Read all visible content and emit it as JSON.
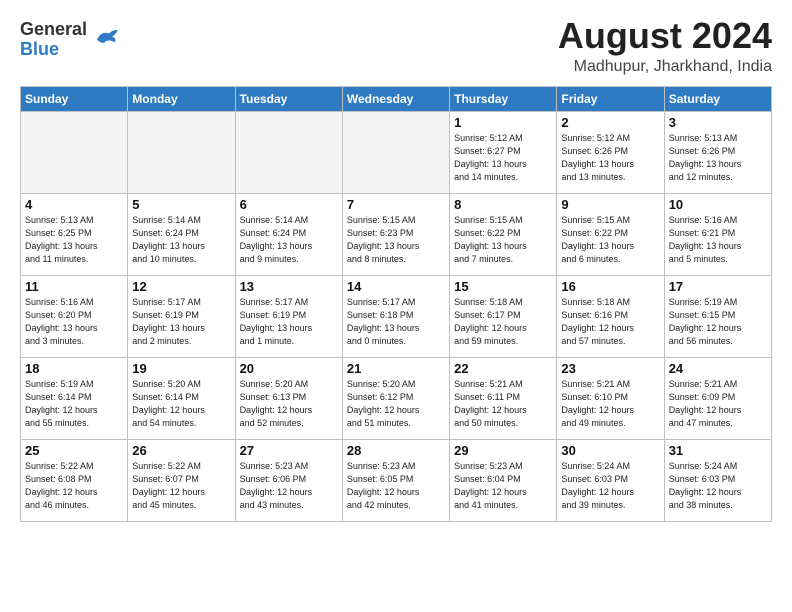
{
  "header": {
    "logo": {
      "line1": "General",
      "line2": "Blue"
    },
    "title": "August 2024",
    "subtitle": "Madhupur, Jharkhand, India"
  },
  "weekdays": [
    "Sunday",
    "Monday",
    "Tuesday",
    "Wednesday",
    "Thursday",
    "Friday",
    "Saturday"
  ],
  "weeks": [
    [
      {
        "day": "",
        "info": ""
      },
      {
        "day": "",
        "info": ""
      },
      {
        "day": "",
        "info": ""
      },
      {
        "day": "",
        "info": ""
      },
      {
        "day": "1",
        "info": "Sunrise: 5:12 AM\nSunset: 6:27 PM\nDaylight: 13 hours\nand 14 minutes."
      },
      {
        "day": "2",
        "info": "Sunrise: 5:12 AM\nSunset: 6:26 PM\nDaylight: 13 hours\nand 13 minutes."
      },
      {
        "day": "3",
        "info": "Sunrise: 5:13 AM\nSunset: 6:26 PM\nDaylight: 13 hours\nand 12 minutes."
      }
    ],
    [
      {
        "day": "4",
        "info": "Sunrise: 5:13 AM\nSunset: 6:25 PM\nDaylight: 13 hours\nand 11 minutes."
      },
      {
        "day": "5",
        "info": "Sunrise: 5:14 AM\nSunset: 6:24 PM\nDaylight: 13 hours\nand 10 minutes."
      },
      {
        "day": "6",
        "info": "Sunrise: 5:14 AM\nSunset: 6:24 PM\nDaylight: 13 hours\nand 9 minutes."
      },
      {
        "day": "7",
        "info": "Sunrise: 5:15 AM\nSunset: 6:23 PM\nDaylight: 13 hours\nand 8 minutes."
      },
      {
        "day": "8",
        "info": "Sunrise: 5:15 AM\nSunset: 6:22 PM\nDaylight: 13 hours\nand 7 minutes."
      },
      {
        "day": "9",
        "info": "Sunrise: 5:15 AM\nSunset: 6:22 PM\nDaylight: 13 hours\nand 6 minutes."
      },
      {
        "day": "10",
        "info": "Sunrise: 5:16 AM\nSunset: 6:21 PM\nDaylight: 13 hours\nand 5 minutes."
      }
    ],
    [
      {
        "day": "11",
        "info": "Sunrise: 5:16 AM\nSunset: 6:20 PM\nDaylight: 13 hours\nand 3 minutes."
      },
      {
        "day": "12",
        "info": "Sunrise: 5:17 AM\nSunset: 6:19 PM\nDaylight: 13 hours\nand 2 minutes."
      },
      {
        "day": "13",
        "info": "Sunrise: 5:17 AM\nSunset: 6:19 PM\nDaylight: 13 hours\nand 1 minute."
      },
      {
        "day": "14",
        "info": "Sunrise: 5:17 AM\nSunset: 6:18 PM\nDaylight: 13 hours\nand 0 minutes."
      },
      {
        "day": "15",
        "info": "Sunrise: 5:18 AM\nSunset: 6:17 PM\nDaylight: 12 hours\nand 59 minutes."
      },
      {
        "day": "16",
        "info": "Sunrise: 5:18 AM\nSunset: 6:16 PM\nDaylight: 12 hours\nand 57 minutes."
      },
      {
        "day": "17",
        "info": "Sunrise: 5:19 AM\nSunset: 6:15 PM\nDaylight: 12 hours\nand 56 minutes."
      }
    ],
    [
      {
        "day": "18",
        "info": "Sunrise: 5:19 AM\nSunset: 6:14 PM\nDaylight: 12 hours\nand 55 minutes."
      },
      {
        "day": "19",
        "info": "Sunrise: 5:20 AM\nSunset: 6:14 PM\nDaylight: 12 hours\nand 54 minutes."
      },
      {
        "day": "20",
        "info": "Sunrise: 5:20 AM\nSunset: 6:13 PM\nDaylight: 12 hours\nand 52 minutes."
      },
      {
        "day": "21",
        "info": "Sunrise: 5:20 AM\nSunset: 6:12 PM\nDaylight: 12 hours\nand 51 minutes."
      },
      {
        "day": "22",
        "info": "Sunrise: 5:21 AM\nSunset: 6:11 PM\nDaylight: 12 hours\nand 50 minutes."
      },
      {
        "day": "23",
        "info": "Sunrise: 5:21 AM\nSunset: 6:10 PM\nDaylight: 12 hours\nand 49 minutes."
      },
      {
        "day": "24",
        "info": "Sunrise: 5:21 AM\nSunset: 6:09 PM\nDaylight: 12 hours\nand 47 minutes."
      }
    ],
    [
      {
        "day": "25",
        "info": "Sunrise: 5:22 AM\nSunset: 6:08 PM\nDaylight: 12 hours\nand 46 minutes."
      },
      {
        "day": "26",
        "info": "Sunrise: 5:22 AM\nSunset: 6:07 PM\nDaylight: 12 hours\nand 45 minutes."
      },
      {
        "day": "27",
        "info": "Sunrise: 5:23 AM\nSunset: 6:06 PM\nDaylight: 12 hours\nand 43 minutes."
      },
      {
        "day": "28",
        "info": "Sunrise: 5:23 AM\nSunset: 6:05 PM\nDaylight: 12 hours\nand 42 minutes."
      },
      {
        "day": "29",
        "info": "Sunrise: 5:23 AM\nSunset: 6:04 PM\nDaylight: 12 hours\nand 41 minutes."
      },
      {
        "day": "30",
        "info": "Sunrise: 5:24 AM\nSunset: 6:03 PM\nDaylight: 12 hours\nand 39 minutes."
      },
      {
        "day": "31",
        "info": "Sunrise: 5:24 AM\nSunset: 6:03 PM\nDaylight: 12 hours\nand 38 minutes."
      }
    ]
  ]
}
